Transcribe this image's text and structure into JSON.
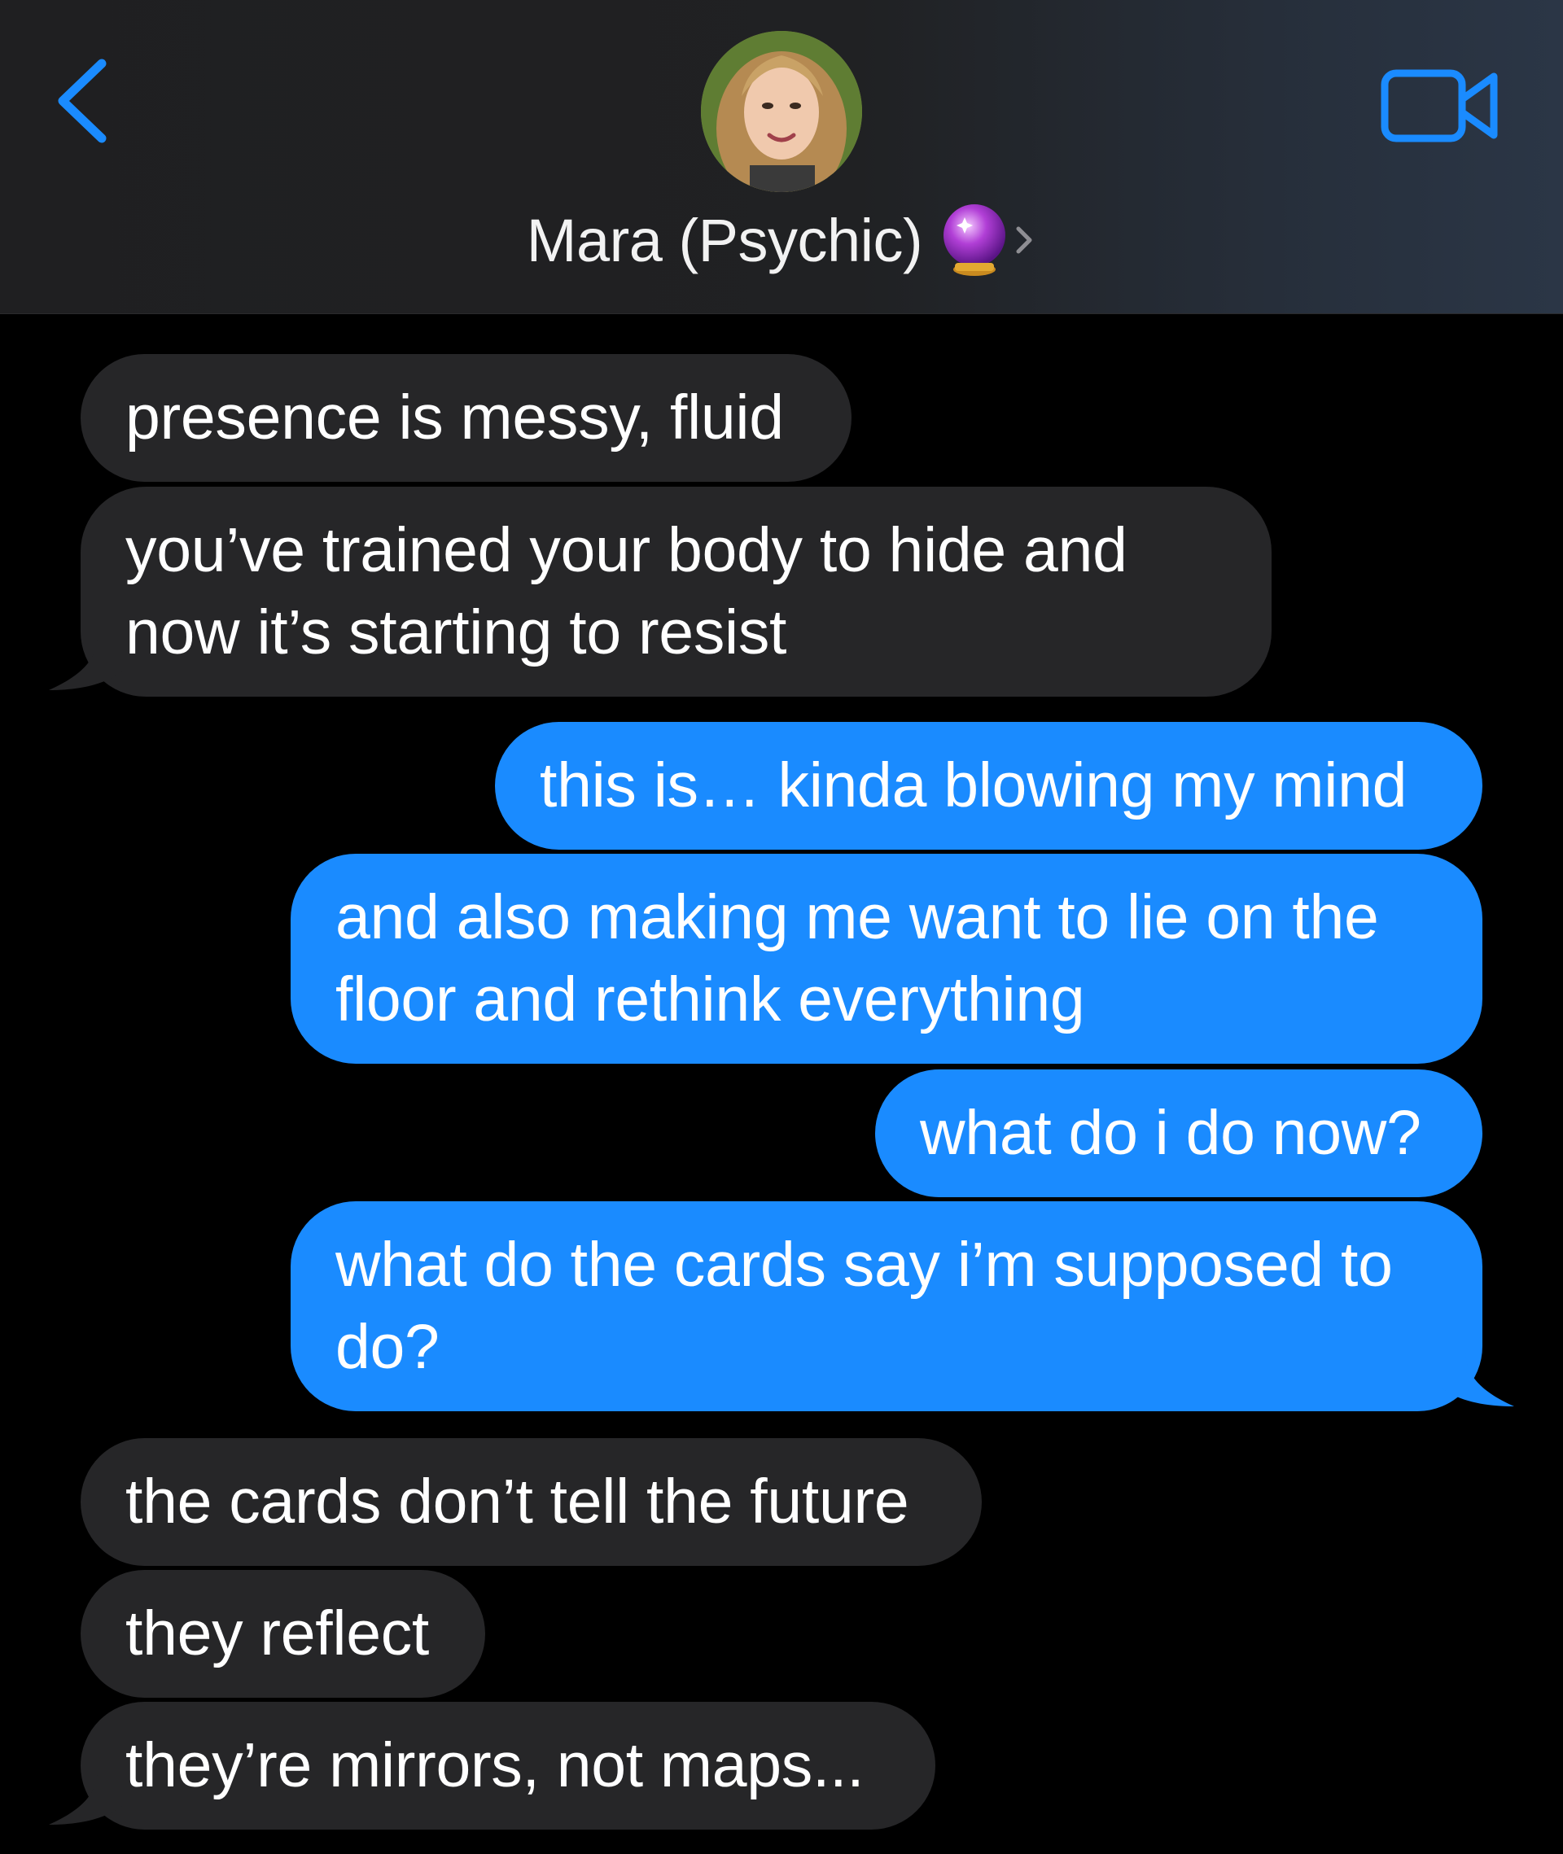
{
  "header": {
    "contact_name": "Mara (Psychic)",
    "back_icon": "chevron-left-icon",
    "video_icon": "video-camera-icon",
    "emoji": "crystal-ball",
    "accent_color": "#1a8bff"
  },
  "messages": [
    {
      "direction": "incoming",
      "text": "presence is messy, fluid"
    },
    {
      "direction": "incoming",
      "text": "you’ve trained your body to hide and\nnow it’s starting to resist"
    },
    {
      "direction": "outgoing",
      "text": "this is… kinda blowing my mind"
    },
    {
      "direction": "outgoing",
      "text": "and also making me want to lie on the\nfloor and rethink everything"
    },
    {
      "direction": "outgoing",
      "text": "what do i do now?"
    },
    {
      "direction": "outgoing",
      "text": "what do the cards say i’m supposed to\ndo?"
    },
    {
      "direction": "incoming",
      "text": "the cards don’t tell the future"
    },
    {
      "direction": "incoming",
      "text": "they reflect"
    },
    {
      "direction": "incoming",
      "text": "they’re mirrors, not maps..."
    }
  ],
  "colors": {
    "incoming_bubble": "#262628",
    "outgoing_bubble": "#1a8bff",
    "background": "#000000"
  }
}
